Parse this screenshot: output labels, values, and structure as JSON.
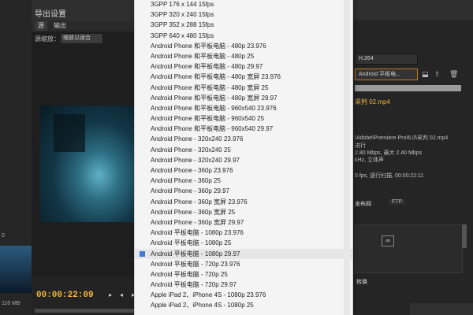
{
  "dialog": {
    "title": "导出设置",
    "tabs": [
      "源",
      "输出"
    ],
    "source_scale_label": "源缩放：",
    "source_scale_value": "缩放以适合",
    "timecode": "00:00:22:09",
    "left_panel_text_1": "116 MB",
    "left_panel_text_2": "0",
    "scrub_icons": [
      "▸",
      "◂",
      "▸"
    ]
  },
  "export": {
    "format_value": "H.264",
    "preset_value": "Android 平板电...",
    "output_name": "采判 02.mp4",
    "summary_lines": [
      "\\Adobe\\Premiere Pro\\6.0\\采判 02.mp4",
      "进行",
      "2.80 Mbps, 最大 2.40 Mbps",
      "kHz, 立体声",
      "5 fps, 逐行扫描, 00:00:22:11"
    ],
    "tab_upload": "发布网",
    "tab_ftp": "FTP",
    "bottom_label": "转换"
  },
  "icons": {
    "save": "save-icon",
    "import": "import-icon",
    "delete": "delete-icon",
    "link": "link-icon"
  },
  "dropdown": {
    "selected_index": 24,
    "items": [
      "3GPP 176 x 144 15fps",
      "3GPP 320 x 240 15fps",
      "3GPP 352 x 288 15fps",
      "3GPP 640 x 480 15fps",
      "Android Phone 和平板电脑 - 480p 23.976",
      "Android Phone 和平板电脑 - 480p 25",
      "Android Phone 和平板电脑 - 480p 29.97",
      "Android Phone 和平板电脑 - 480p 宽屏 23.976",
      "Android Phone 和平板电脑 - 480p 宽屏 25",
      "Android Phone 和平板电脑 - 480p 宽屏 29.97",
      "Android Phone 和平板电脑 - 960x540 23.976",
      "Android Phone 和平板电脑 - 960x540 25",
      "Android Phone 和平板电脑 - 960x540 29.97",
      "Android Phone - 320x240 23.976",
      "Android Phone - 320x240 25",
      "Android Phone - 320x240 29.97",
      "Android Phone - 360p 23.976",
      "Android Phone - 360p 25",
      "Android Phone - 360p 29.97",
      "Android Phone - 360p 宽屏 23.976",
      "Android Phone - 360p 宽屏 25",
      "Android Phone - 360p 宽屏 29.97",
      "Android 平板电脑 - 1080p 23.976",
      "Android 平板电脑 - 1080p 25",
      "Android 平板电脑 - 1080p 29.97",
      "Android 平板电脑 - 720p 23.976",
      "Android 平板电脑 - 720p 25",
      "Android 平板电脑 - 720p 29.97",
      "Apple iPad 2、iPhone 4S - 1080p 23.976",
      "Apple iPad 2、iPhone 4S - 1080p 25"
    ]
  }
}
